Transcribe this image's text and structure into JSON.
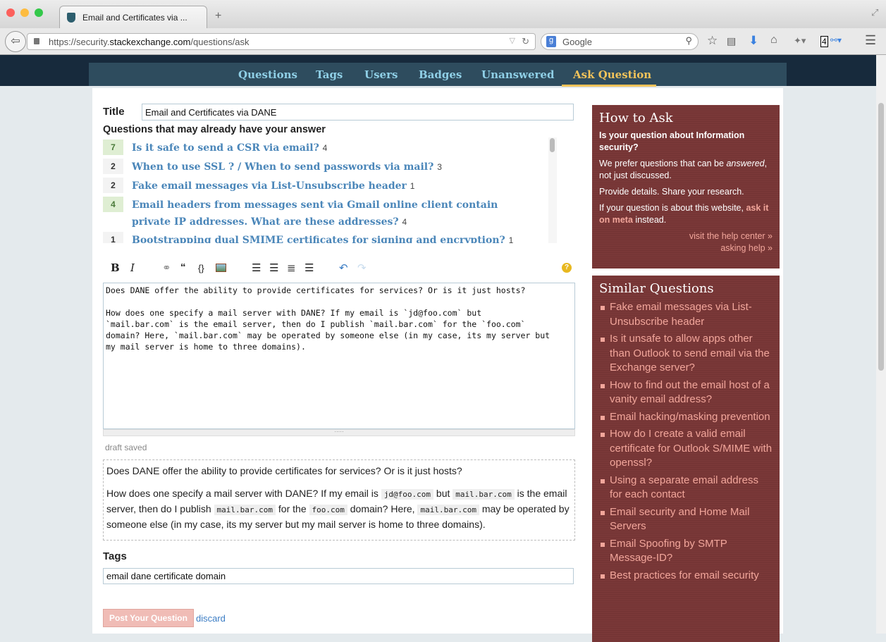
{
  "browser": {
    "tab_title": "Email and Certificates via ...",
    "url_prefix": "https://security.",
    "url_domain": "stackexchange.com",
    "url_path": "/questions/ask",
    "search_placeholder": "Google",
    "badge": "4"
  },
  "nav": [
    "Questions",
    "Tags",
    "Users",
    "Badges",
    "Unanswered",
    "Ask Question"
  ],
  "form": {
    "title_label": "Title",
    "title_value": "Email and Certificates via DANE",
    "similar_heading": "Questions that may already have your answer",
    "suggestions": [
      {
        "votes": "7",
        "title": "Is it safe to send a CSR via email?",
        "answers": "4",
        "accepted": true
      },
      {
        "votes": "2",
        "title": "When to use SSL ? / When to send passwords via mail?",
        "answers": "3",
        "accepted": false
      },
      {
        "votes": "2",
        "title": "Fake email messages via List-Unsubscribe header",
        "answers": "1",
        "accepted": false
      },
      {
        "votes": "4",
        "title": "Email headers from messages sent via Gmail online client contain private IP addresses. What are these addresses?",
        "answers": "4",
        "accepted": true
      },
      {
        "votes": "1",
        "title": "Bootstrapping dual SMIME certificates for signing and encryption?",
        "answers": "1",
        "accepted": false
      }
    ],
    "editor_text": "Does DANE offer the ability to provide certificates for services? Or is it just hosts?\n\nHow does one specify a mail server with DANE? If my email is `jd@foo.com` but\n`mail.bar.com` is the email server, then do I publish `mail.bar.com` for the `foo.com`\ndomain? Here, `mail.bar.com` may be operated by someone else (in my case, its my server but\nmy mail server is home to three domains).",
    "draft_status": "draft saved",
    "preview": {
      "p1": "Does DANE offer the ability to provide certificates for services? Or is it just hosts?",
      "a": "How does one specify a mail server with DANE? If my email is ",
      "c1": "jd@foo.com",
      "b": " but ",
      "c2": "mail.bar.com",
      "c": " is the email server, then do I publish ",
      "c3": "mail.bar.com",
      "d": " for the ",
      "c4": "foo.com",
      "e": " domain? Here, ",
      "c5": "mail.bar.com",
      "f": " may be operated by someone else (in my case, its my server but my mail server is home to three domains)."
    },
    "tags_label": "Tags",
    "tags_value": "email dane certificate domain",
    "post_label": "Post Your Question",
    "discard_label": "discard"
  },
  "how_to_ask": {
    "title": "How to Ask",
    "q": "Is your question about Information security?",
    "p1a": "We prefer questions that can be ",
    "p1em": "answered",
    "p1b": ", not just discussed.",
    "p2": "Provide details. Share your research.",
    "p3a": "If your question is about this website, ",
    "p3link": "ask it on meta",
    "p3b": " instead.",
    "help_link": "visit the help center »",
    "asking_link": "asking help »"
  },
  "similar": {
    "title": "Similar Questions",
    "items": [
      "Fake email messages via List-Unsubscribe header",
      "Is it unsafe to allow apps other than Outlook to send email via the Exchange server?",
      "How to find out the email host of a vanity email address?",
      "Email hacking/masking prevention",
      "How do I create a valid email certificate for Outlook S/MIME with openssl?",
      "Using a separate email address for each contact",
      "Email security and Home Mail Servers",
      "Email Spoofing by SMTP Message-ID?",
      "Best practices for email security"
    ]
  }
}
